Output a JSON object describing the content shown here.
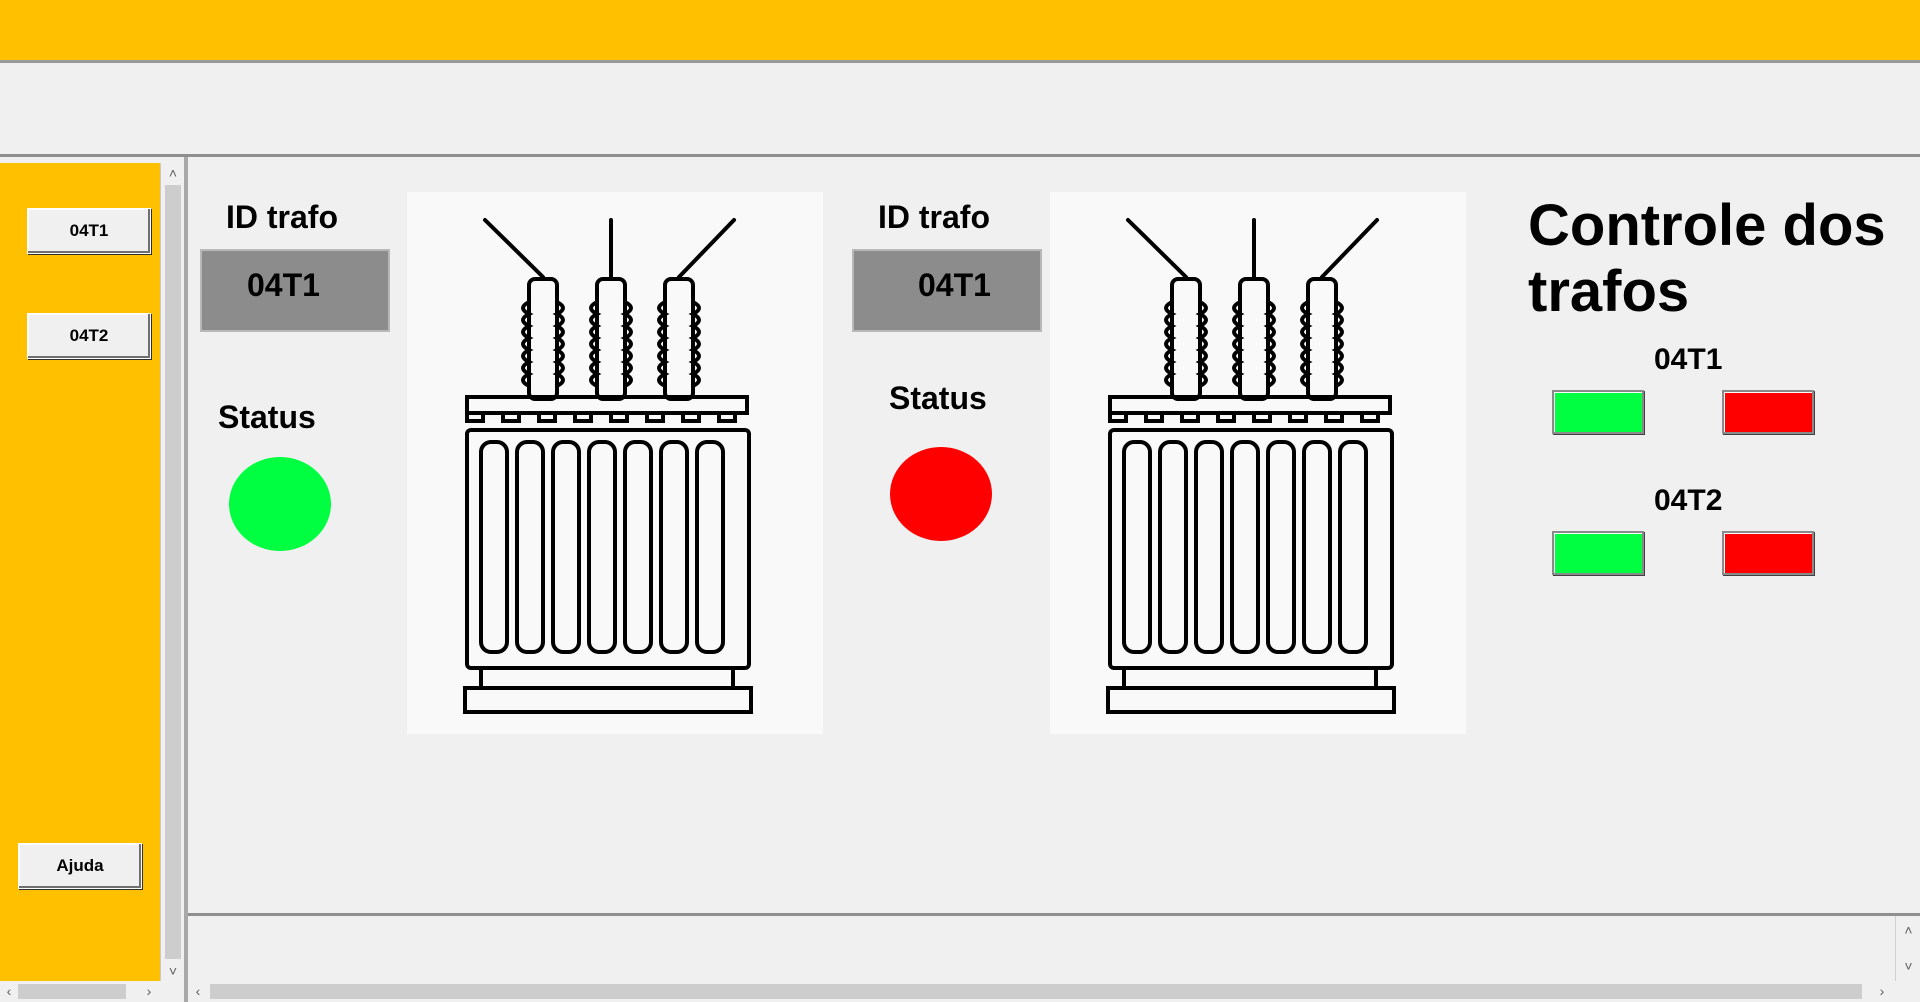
{
  "sidebar": {
    "buttons": [
      {
        "label": "04T1"
      },
      {
        "label": "04T2"
      },
      {
        "label": "Ajuda"
      }
    ]
  },
  "panels": [
    {
      "id_label": "ID trafo",
      "id_value": "04T1",
      "status_label": "Status",
      "status_color": "#00ff40"
    },
    {
      "id_label": "ID trafo",
      "id_value": "04T1",
      "status_label": "Status",
      "status_color": "#ff0000"
    }
  ],
  "control": {
    "title": "Controle dos trafos",
    "groups": [
      {
        "label": "04T1",
        "on_color": "#00ff40",
        "off_color": "#ff0000"
      },
      {
        "label": "04T2",
        "on_color": "#00ff40",
        "off_color": "#ff0000"
      }
    ]
  },
  "scroll_glyphs": {
    "up": "˄",
    "down": "˅",
    "left": "‹",
    "right": "›"
  },
  "colors": {
    "accent_bar": "#ffc000",
    "id_box": "#8c8c8c"
  }
}
